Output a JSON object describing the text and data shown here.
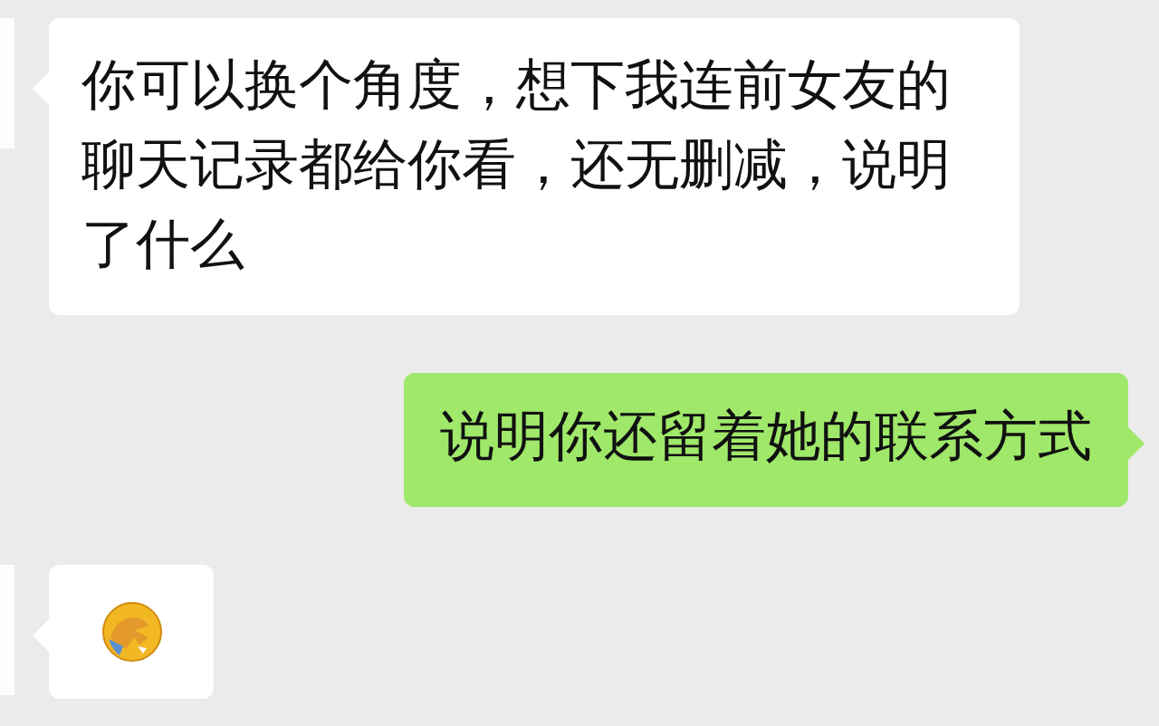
{
  "messages": [
    {
      "outgoing": false,
      "kind": "text",
      "text": "你可以换个角度，想下我连前女友的聊天记录都给你看，还无删减，说明了什么"
    },
    {
      "outgoing": true,
      "kind": "text",
      "text": "说明你还留着她的联系方式"
    },
    {
      "outgoing": false,
      "kind": "emoji"
    }
  ]
}
